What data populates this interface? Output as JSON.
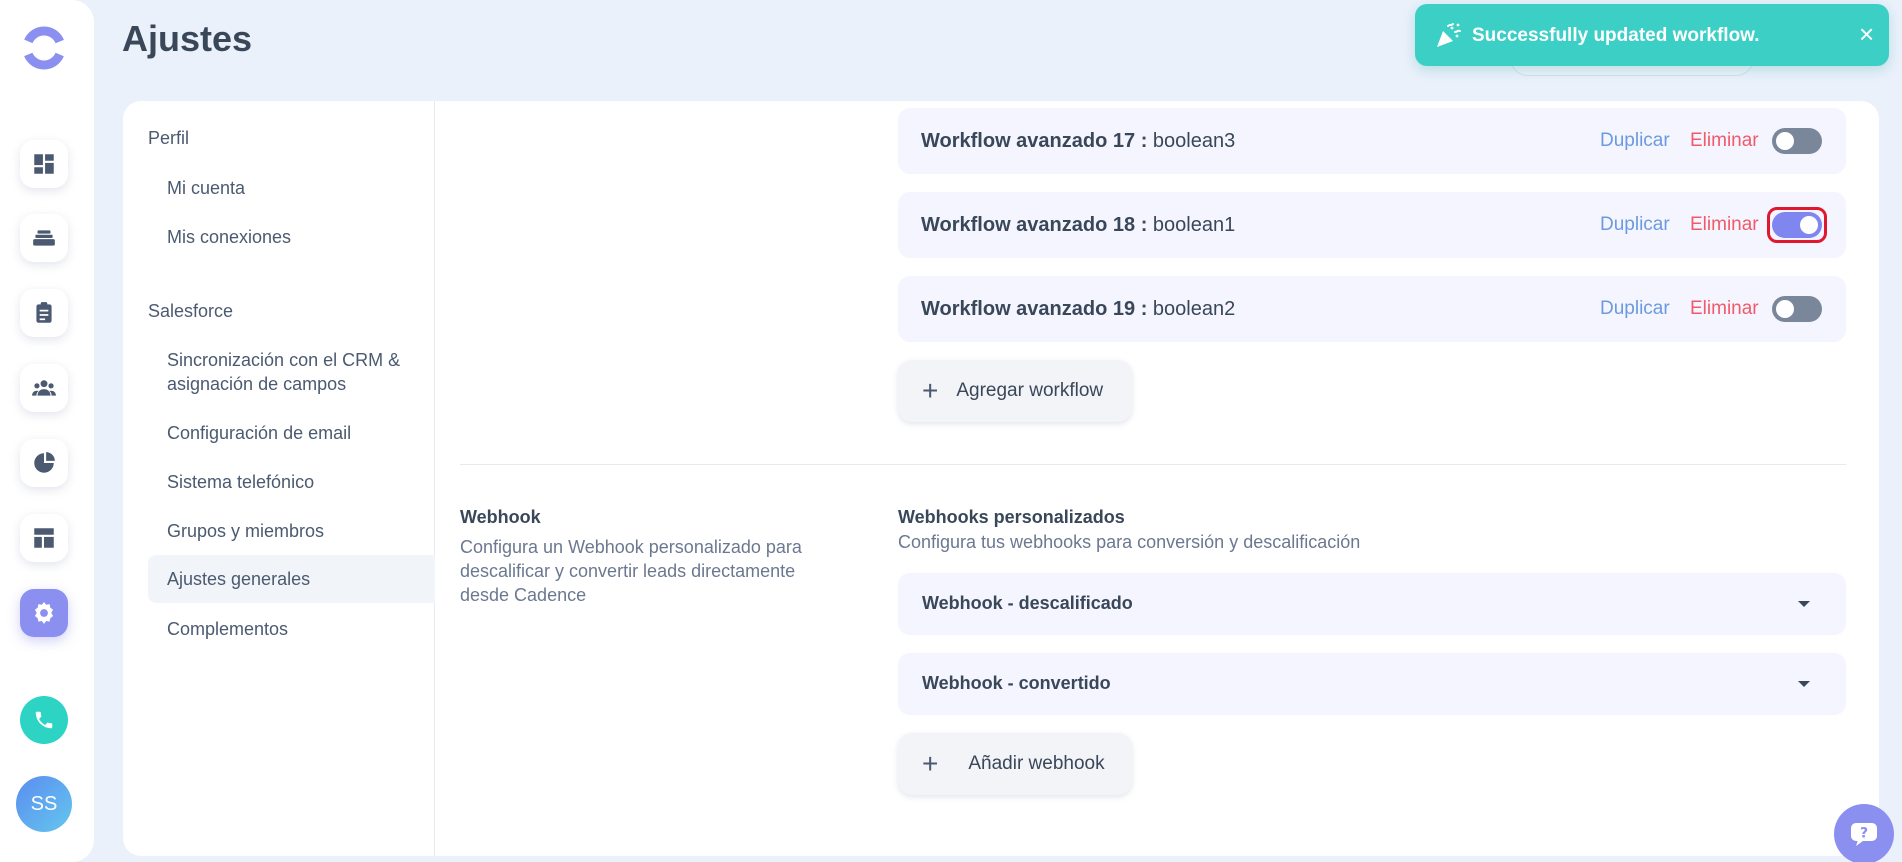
{
  "page": {
    "title": "Ajustes"
  },
  "user": {
    "initials": "SS"
  },
  "subnav": {
    "profile_section": "Perfil",
    "profile_items": [
      "Mi cuenta",
      "Mis conexiones"
    ],
    "salesforce_section": "Salesforce",
    "salesforce_items": [
      "Sincronización con el CRM & asignación de campos",
      "Configuración de email",
      "Sistema telefónico",
      "Grupos y miembros",
      "Ajustes generales",
      "Complementos"
    ],
    "active": "Ajustes generales"
  },
  "workflows": [
    {
      "name": "Workflow avanzado 17 :",
      "field": "boolean3",
      "duplicate": "Duplicar",
      "delete": "Eliminar",
      "enabled": false
    },
    {
      "name": "Workflow avanzado 18 :",
      "field": "boolean1",
      "duplicate": "Duplicar",
      "delete": "Eliminar",
      "enabled": true
    },
    {
      "name": "Workflow avanzado 19 :",
      "field": "boolean2",
      "duplicate": "Duplicar",
      "delete": "Eliminar",
      "enabled": false
    }
  ],
  "add_workflow": {
    "plus": "+",
    "label": "Agregar workflow"
  },
  "webhook": {
    "title": "Webhook",
    "description": "Configura un Webhook personalizado para descalificar y convertir leads directamente desde Cadence",
    "custom_title": "Webhooks personalizados",
    "custom_description": "Configura tus webhooks para conversión y descalificación",
    "items": [
      "Webhook - descalificado",
      "Webhook - convertido"
    ],
    "add_plus": "+",
    "add_label": "Añadir webhook"
  },
  "toast": {
    "message": "Successfully updated workflow.",
    "close": "×"
  },
  "colors": {
    "accent": "#8b8ff0",
    "toast": "#3ccfc6",
    "duplicate": "#6b9ae0",
    "delete": "#f05a6a",
    "focus_ring": "#e0182e"
  },
  "icons": {
    "rail": [
      "dashboard-icon",
      "cadences-icon",
      "tasks-icon",
      "people-icon",
      "analytics-icon",
      "templates-icon",
      "settings-icon"
    ],
    "call": "phone-icon",
    "help": "question-icon",
    "toast": "party-popper-icon"
  }
}
